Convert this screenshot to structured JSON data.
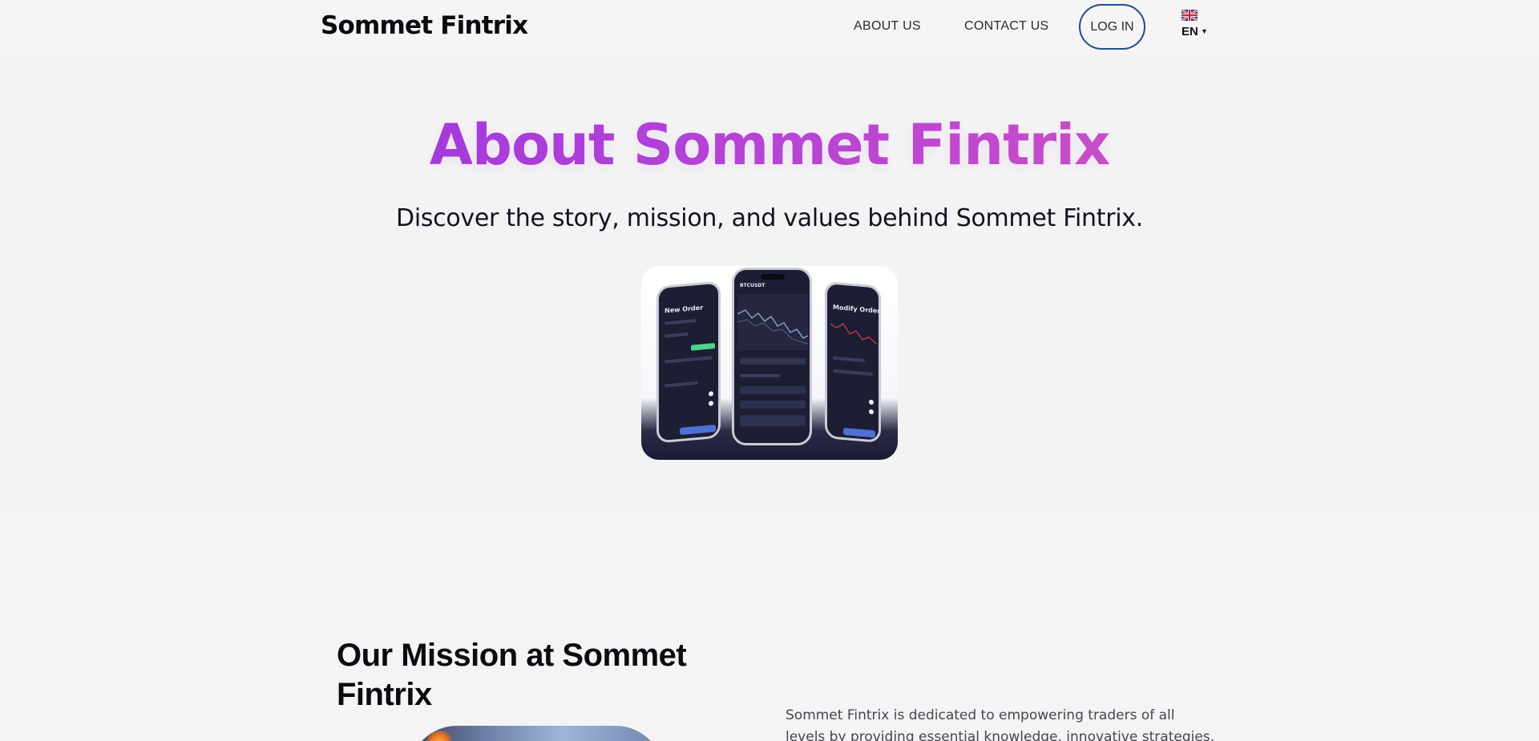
{
  "header": {
    "logo": "Sommet Fintrix",
    "nav": {
      "about": "ABOUT US",
      "contact": "CONTACT US"
    },
    "login": "LOG IN",
    "language": {
      "code": "EN",
      "flag_icon": "uk-flag-icon"
    }
  },
  "hero": {
    "title": "About Sommet Fintrix",
    "subtitle": "Discover the story, mission, and values behind Sommet Fintrix.",
    "phones": {
      "left_title": "New Order",
      "center_title": "BTCUSDT",
      "right_title": "Modify Order"
    },
    "title_gradient": [
      "#8d2be3",
      "#df5bb6"
    ]
  },
  "mission": {
    "title": "Our Mission at Sommet Fintrix",
    "text": "Sommet Fintrix is dedicated to empowering traders of all levels by providing essential knowledge, innovative strategies, and a"
  },
  "colors": {
    "login_border": "#1f4e8c",
    "background": "#f4f4f5"
  }
}
